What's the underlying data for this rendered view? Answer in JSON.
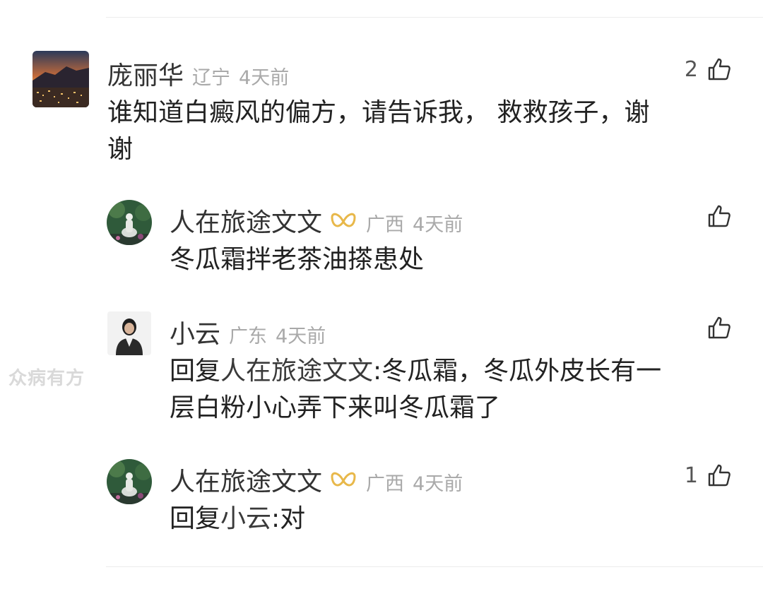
{
  "comments": [
    {
      "name": "庞丽华",
      "location": "辽宁",
      "time": "4天前",
      "likes": "2",
      "text_lines": [
        "谁知道白癜风的偏方，请告诉我， 救救孩子，谢",
        "谢"
      ]
    },
    {
      "name": "人在旅途文文",
      "location": "广西",
      "time": "4天前",
      "likes": "",
      "text_lines": [
        "冬瓜霜拌老茶油搽患处"
      ]
    },
    {
      "name": "小云",
      "location": "广东",
      "time": "4天前",
      "likes": "",
      "reply_prefix": "回复",
      "reply_target": "人在旅途文文",
      "text_lines": [
        ":冬瓜霜，冬瓜外皮长有一",
        "层白粉小心弄下来叫冬瓜霜了"
      ]
    },
    {
      "name": "人在旅途文文",
      "location": "广西",
      "time": "4天前",
      "likes": "1",
      "reply_prefix": "回复",
      "reply_target": "小云",
      "text_lines": [
        ":对"
      ]
    }
  ],
  "watermark": "众病有方",
  "icons": {
    "like": "thumbs-up-icon",
    "badge": "gold-badge-icon"
  },
  "colors": {
    "badge_gold": "#e8b84a",
    "meta_gray": "#a9a9a9"
  }
}
